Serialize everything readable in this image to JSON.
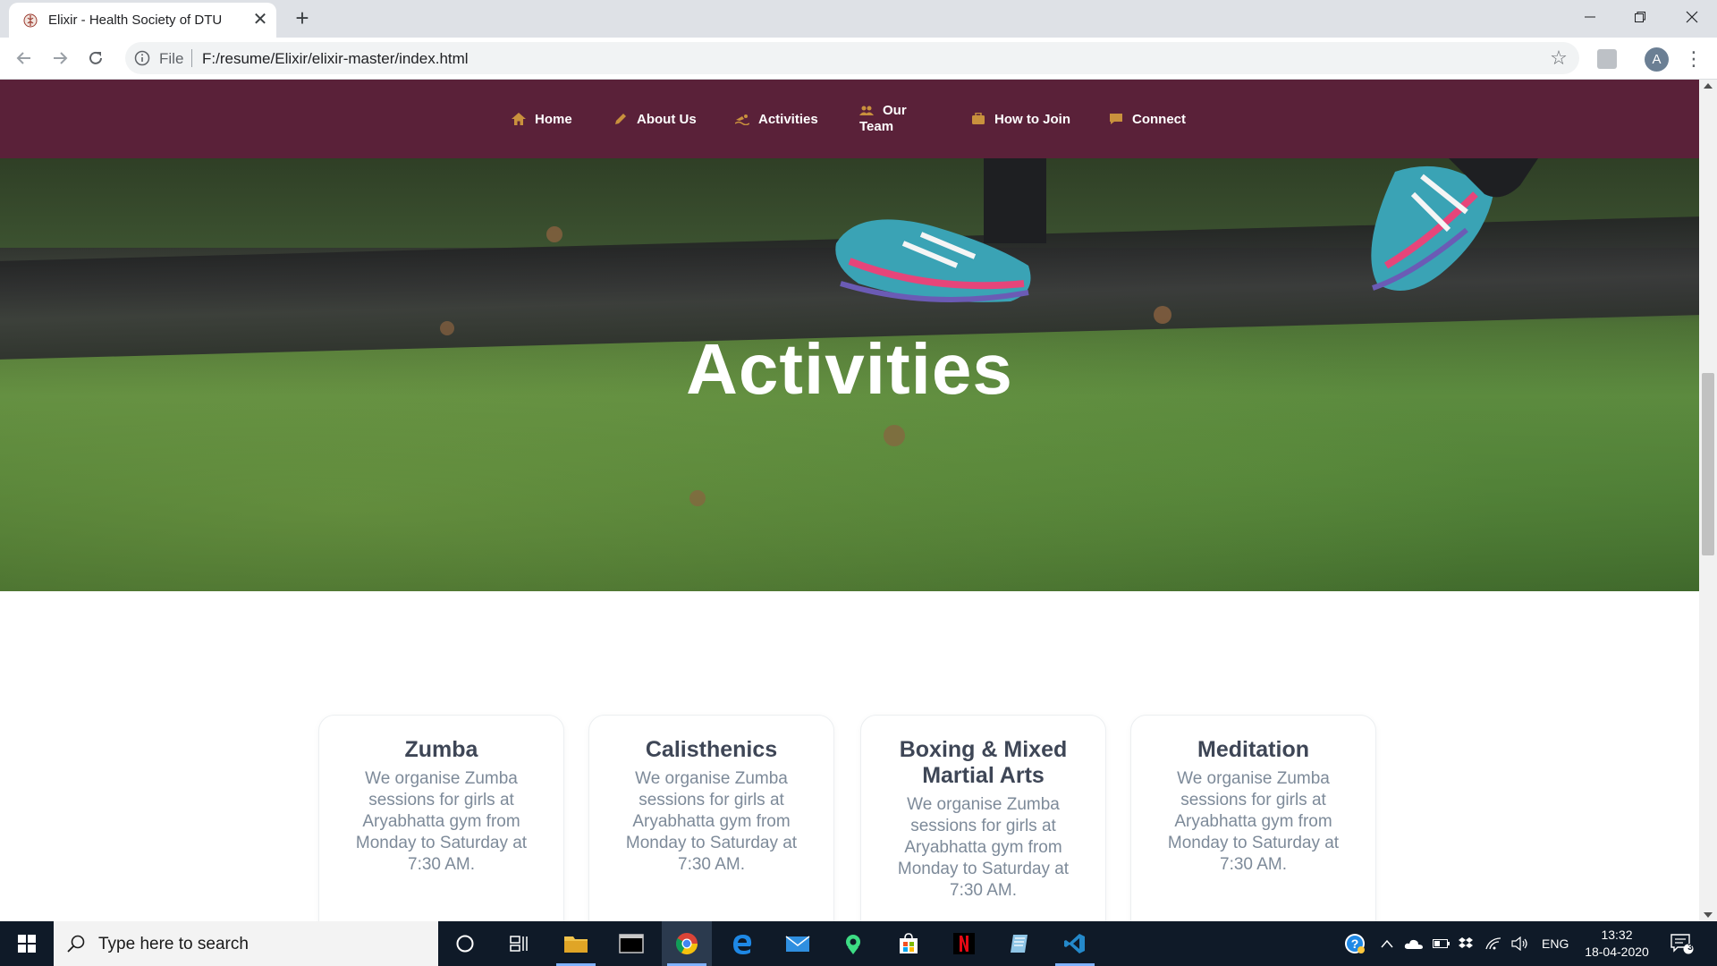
{
  "browser": {
    "tab_title": "Elixir - Health Society of DTU",
    "tab_close": "✕",
    "new_tab": "+",
    "omnibox_scheme": "File",
    "url": "F:/resume/Elixir/elixir-master/index.html",
    "profile_initial": "A"
  },
  "site": {
    "nav": {
      "home": "Home",
      "about": "About Us",
      "activities": "Activities",
      "team_line1": "Our",
      "team_line2": "Team",
      "join": "How to Join",
      "connect": "Connect"
    },
    "hero_title": "Activities",
    "cards": [
      {
        "title": "Zumba",
        "body": "We organise Zumba sessions for girls at Aryabhatta gym from Monday to Saturday at 7:30 AM."
      },
      {
        "title": "Calisthenics",
        "body": "We organise Zumba sessions for girls at Aryabhatta gym from Monday to Saturday at 7:30 AM."
      },
      {
        "title": "Boxing & Mixed Martial Arts",
        "body": "We organise Zumba sessions for girls at Aryabhatta gym from Monday to Saturday at 7:30 AM."
      },
      {
        "title": "Meditation",
        "body": "We organise Zumba sessions for girls at Aryabhatta gym from Monday to Saturday at 7:30 AM."
      }
    ]
  },
  "taskbar": {
    "search_placeholder": "Type here to search",
    "language": "ENG",
    "time": "13:32",
    "date": "18-04-2020",
    "notification_count": "3"
  },
  "colors": {
    "nav_background": "#5a2139",
    "nav_icon_accent": "#c9913d",
    "card_title": "#3e4656",
    "card_body": "#7d8a99"
  }
}
